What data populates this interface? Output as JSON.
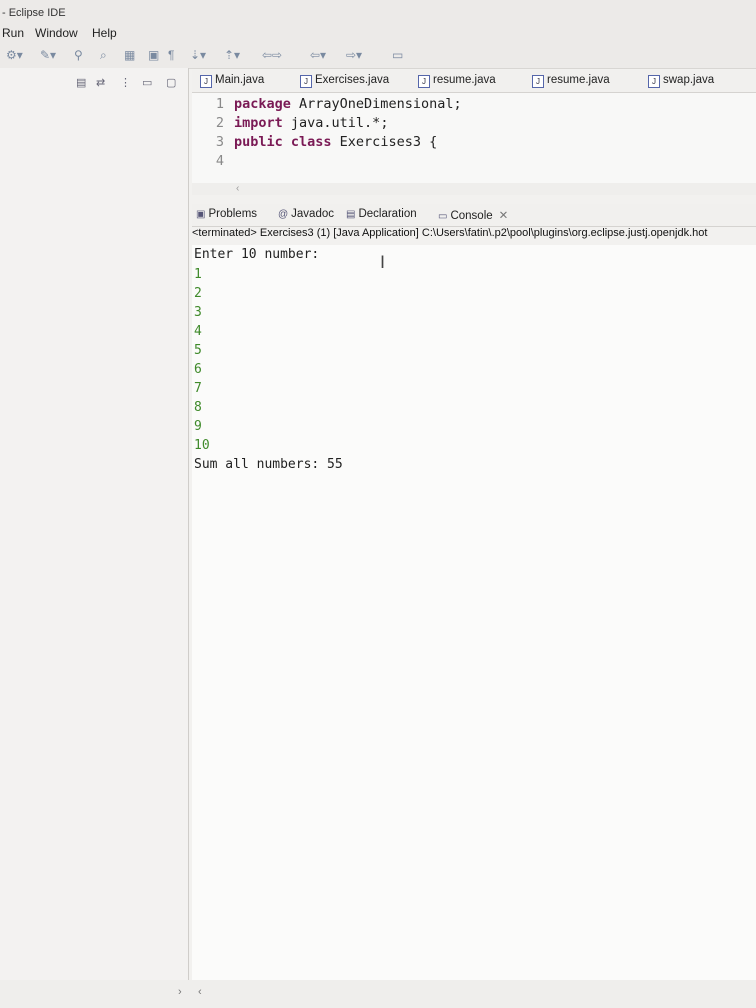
{
  "window": {
    "title": "- Eclipse IDE"
  },
  "menu": {
    "items": [
      "Run",
      "Window",
      "Help"
    ]
  },
  "editor": {
    "tabs": [
      "Main.java",
      "Exercises.java",
      "resume.java",
      "resume.java",
      "swap.java"
    ],
    "lines": [
      {
        "num": "1",
        "kw": "package",
        "text": " ArrayOneDimensional;"
      },
      {
        "num": "2",
        "kw": "import",
        "text": " java.util.*;"
      },
      {
        "num": "3",
        "kw": "public class",
        "text": " Exercises3 {"
      },
      {
        "num": "4",
        "kw": "",
        "text": ""
      }
    ]
  },
  "console_view": {
    "tabs": [
      "Problems",
      "Javadoc",
      "Declaration",
      "Console"
    ],
    "status": "<terminated> Exercises3 (1) [Java Application] C:\\Users\\fatin\\.p2\\pool\\plugins\\org.eclipse.justj.openjdk.hot",
    "prompt": "Enter 10 number:",
    "inputs": [
      "1",
      "2",
      "3",
      "4",
      "5",
      "6",
      "7",
      "8",
      "9",
      "10"
    ],
    "result": "Sum all numbers: 55"
  }
}
